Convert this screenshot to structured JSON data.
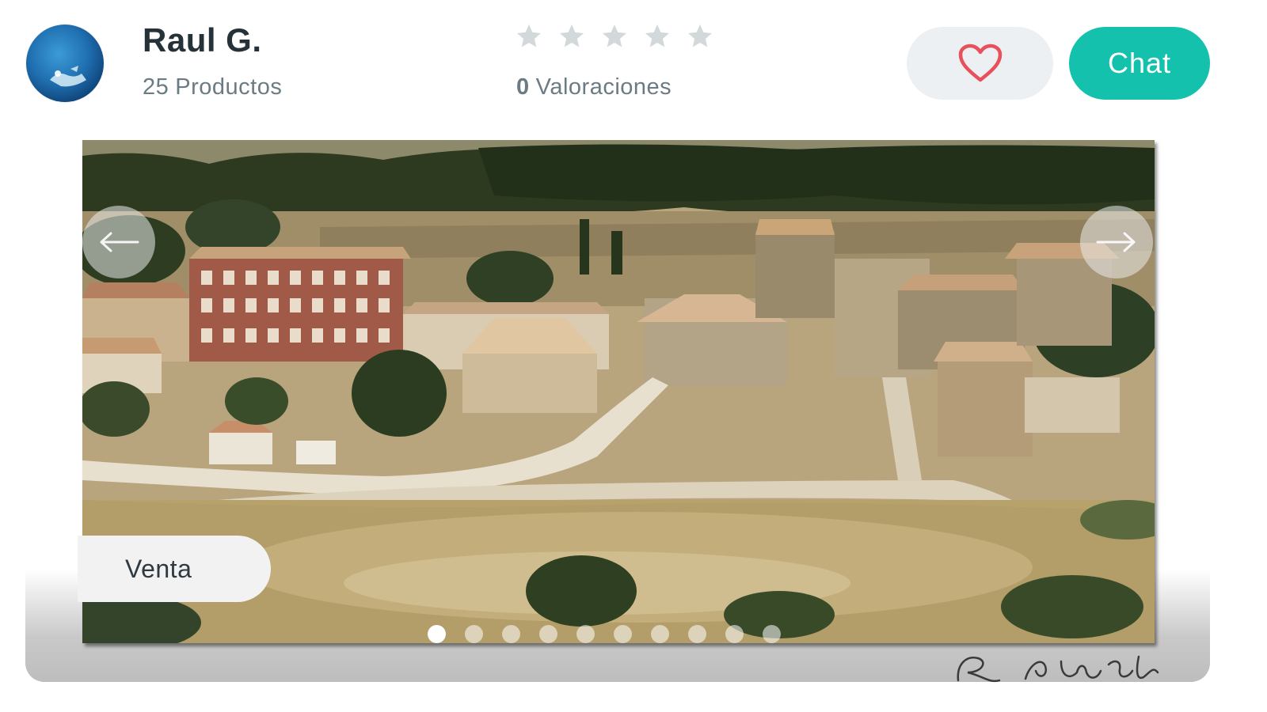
{
  "seller": {
    "name": "Raul G.",
    "products_count": "25",
    "products_label": "Productos",
    "avatar_icon": "avatar-photo"
  },
  "rating": {
    "stars_filled": 0,
    "stars_total": 5,
    "count": "0",
    "label": "Valoraciones"
  },
  "actions": {
    "favorite_icon": "heart-icon",
    "chat_label": "Chat"
  },
  "colors": {
    "accent": "#13c1ac",
    "heart": "#e8505b",
    "star_empty": "#d3d8db"
  },
  "carousel": {
    "badge_label": "Venta",
    "slide_count": 10,
    "active_index": 0,
    "prev_icon": "arrow-left-icon",
    "next_icon": "arrow-right-icon"
  }
}
